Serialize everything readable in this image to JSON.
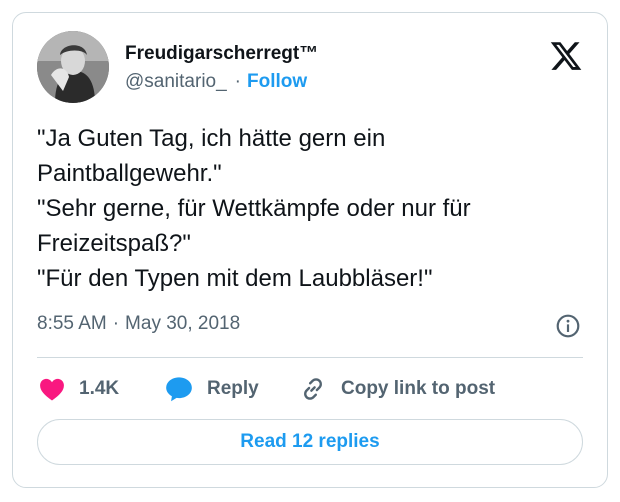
{
  "author": {
    "display_name": "Freudigarscherregt™",
    "handle": "@sanitario_",
    "separator": "·",
    "follow_label": "Follow"
  },
  "tweet": {
    "lines": [
      "\"Ja Guten Tag, ich hätte gern ein",
      "Paintballgewehr.\"",
      "\"Sehr gerne, für Wettkämpfe oder nur für",
      "Freizeitspaß?\"",
      "\"Für den Typen mit dem Laubbläser!\""
    ],
    "time": "8:55 AM",
    "separator": "·",
    "date": "May 30, 2018"
  },
  "actions": {
    "like_count": "1.4K",
    "reply_label": "Reply",
    "copy_label": "Copy link to post",
    "read_replies_label": "Read 12 replies"
  },
  "icons": {
    "brand": "x-logo-icon",
    "info": "info-icon",
    "like": "heart-icon",
    "reply": "speech-bubble-icon",
    "copy": "link-icon"
  },
  "colors": {
    "accent": "#1d9bf0",
    "like": "#f91880",
    "text": "#0f1419",
    "secondary": "#536471",
    "border": "#cfd9de"
  }
}
